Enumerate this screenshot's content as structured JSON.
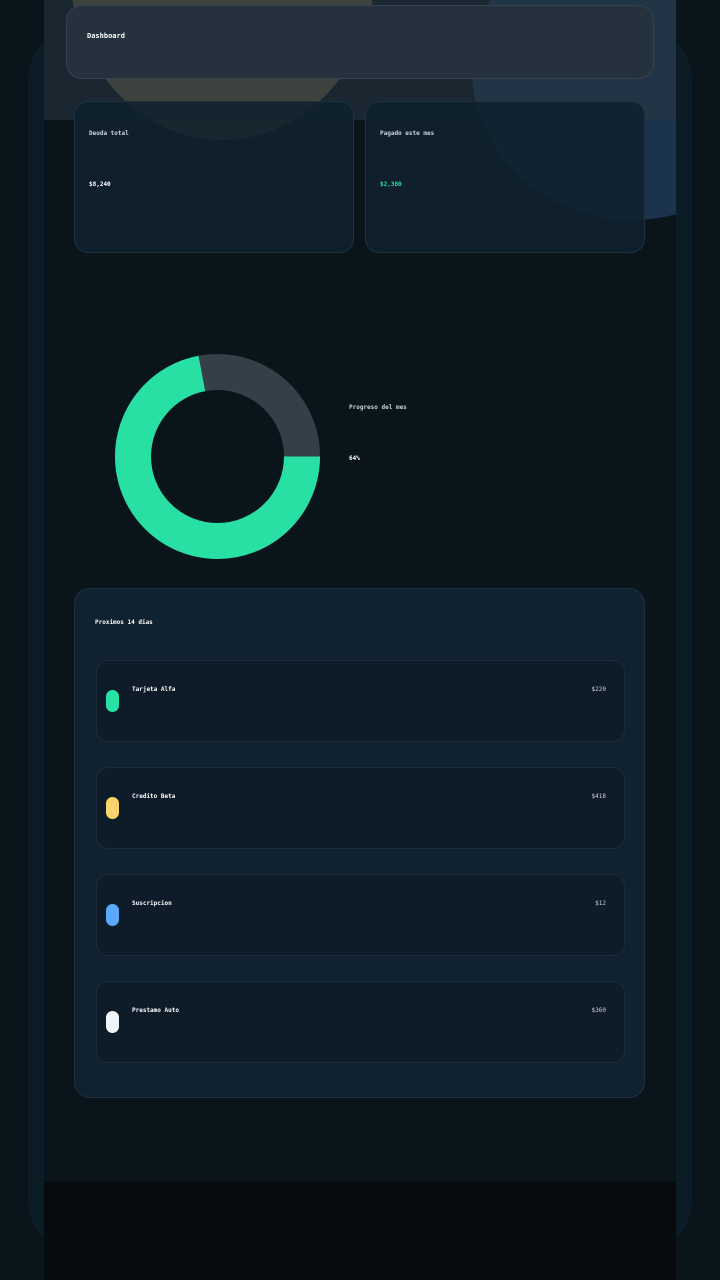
{
  "header": {
    "title": "Dashboard"
  },
  "stats": [
    {
      "label": "Deuda total",
      "value": "$8,240",
      "accent": false
    },
    {
      "label": "Pagado este mes",
      "value": "$2,380",
      "accent": true
    }
  ],
  "progress": {
    "label": "Progreso del mes",
    "value_text": "64%",
    "fraction": 0.72,
    "filled_color": "#29e0a4",
    "track_color": "#353f47"
  },
  "upcoming": {
    "title": "Proximos 14 dias",
    "items": [
      {
        "name": "Tarjeta Alfa",
        "amount": "$220",
        "color": "#29e0a4"
      },
      {
        "name": "Credito Beta",
        "amount": "$418",
        "color": "#ffd36b"
      },
      {
        "name": "Suscripcion",
        "amount": "$12",
        "color": "#5aa9ff"
      },
      {
        "name": "Prestamo Auto",
        "amount": "$360",
        "color": "#f2f5f7"
      }
    ]
  },
  "colors": {
    "background": "#0a141b",
    "accent": "#29e0a4",
    "card": "#10212f"
  }
}
